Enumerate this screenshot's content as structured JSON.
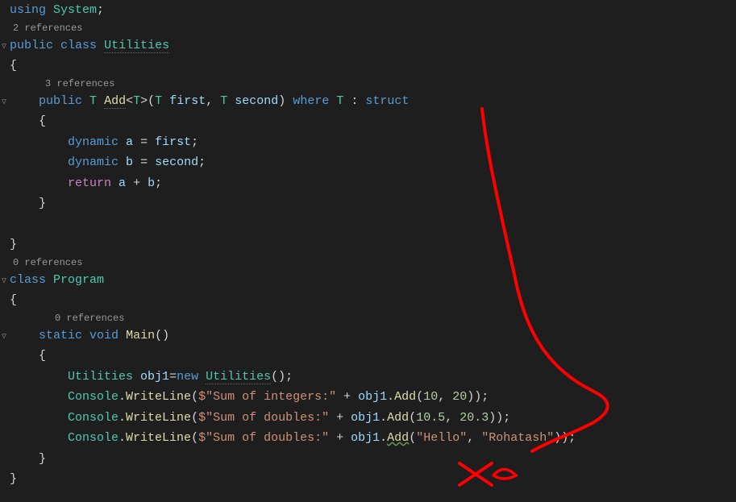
{
  "line1": {
    "using": "using",
    "system": "System",
    "semi": ";"
  },
  "codelens1": "2 references",
  "line2": {
    "public": "public",
    "class": "class",
    "name": "Utilities"
  },
  "brace_open": "{",
  "brace_close": "}",
  "codelens2": "3 references",
  "line4": {
    "public": "public",
    "T1": "T",
    "Add": "Add",
    "lt": "<",
    "T2": "T",
    "gt": ">",
    "lp": "(",
    "T3": "T",
    "first": "first",
    "comma": ",",
    "T4": "T",
    "second": "second",
    "rp": ")",
    "where": "where",
    "T5": "T",
    "colon": ":",
    "struct": "struct"
  },
  "line5": {
    "dynamic": "dynamic",
    "a": "a",
    "eq": "=",
    "first": "first",
    "semi": ";"
  },
  "line6": {
    "dynamic": "dynamic",
    "b": "b",
    "eq": "=",
    "second": "second",
    "semi": ";"
  },
  "line7": {
    "return": "return",
    "a": "a",
    "plus": "+",
    "b": "b",
    "semi": ";"
  },
  "codelens3": "0 references",
  "line_prog": {
    "class": "class",
    "name": "Program"
  },
  "codelens4": "0 references",
  "line_main": {
    "static": "static",
    "void": "void",
    "Main": "Main",
    "parens": "()"
  },
  "line_util": {
    "Utilities": "Utilities",
    "obj1": "obj1",
    "eq": "=",
    "new": "new",
    "Utilities2": "Utilities",
    "parens": "()",
    "semi": ";"
  },
  "line_w1": {
    "Console": "Console",
    "dot": ".",
    "WriteLine": "WriteLine",
    "lp": "(",
    "dollar": "$",
    "str": "\"Sum of integers:\"",
    "plus": " + ",
    "obj1": "obj1",
    "dot2": ".",
    "Add": "Add",
    "lp2": "(",
    "n1": "10",
    "comma": ", ",
    "n2": "20",
    "rp2": ")",
    "rp": ")",
    "semi": ";"
  },
  "line_w2": {
    "Console": "Console",
    "dot": ".",
    "WriteLine": "WriteLine",
    "lp": "(",
    "dollar": "$",
    "str": "\"Sum of doubles:\"",
    "plus": " + ",
    "obj1": "obj1",
    "dot2": ".",
    "Add": "Add",
    "lp2": "(",
    "n1": "10.5",
    "comma": ", ",
    "n2": "20.3",
    "rp2": ")",
    "rp": ")",
    "semi": ";"
  },
  "line_w3": {
    "Console": "Console",
    "dot": ".",
    "WriteLine": "WriteLine",
    "lp": "(",
    "dollar": "$",
    "str": "\"Sum of doubles:\"",
    "plus": " + ",
    "obj1": "obj1",
    "dot2": ".",
    "Add": "Add",
    "lp2": "(",
    "s1": "\"Hello\"",
    "comma": ", ",
    "s2": "\"Rohatash\"",
    "rp2": ")",
    "rp": ")",
    "semi": ";"
  },
  "annotation": {
    "color": "#ff0000"
  }
}
